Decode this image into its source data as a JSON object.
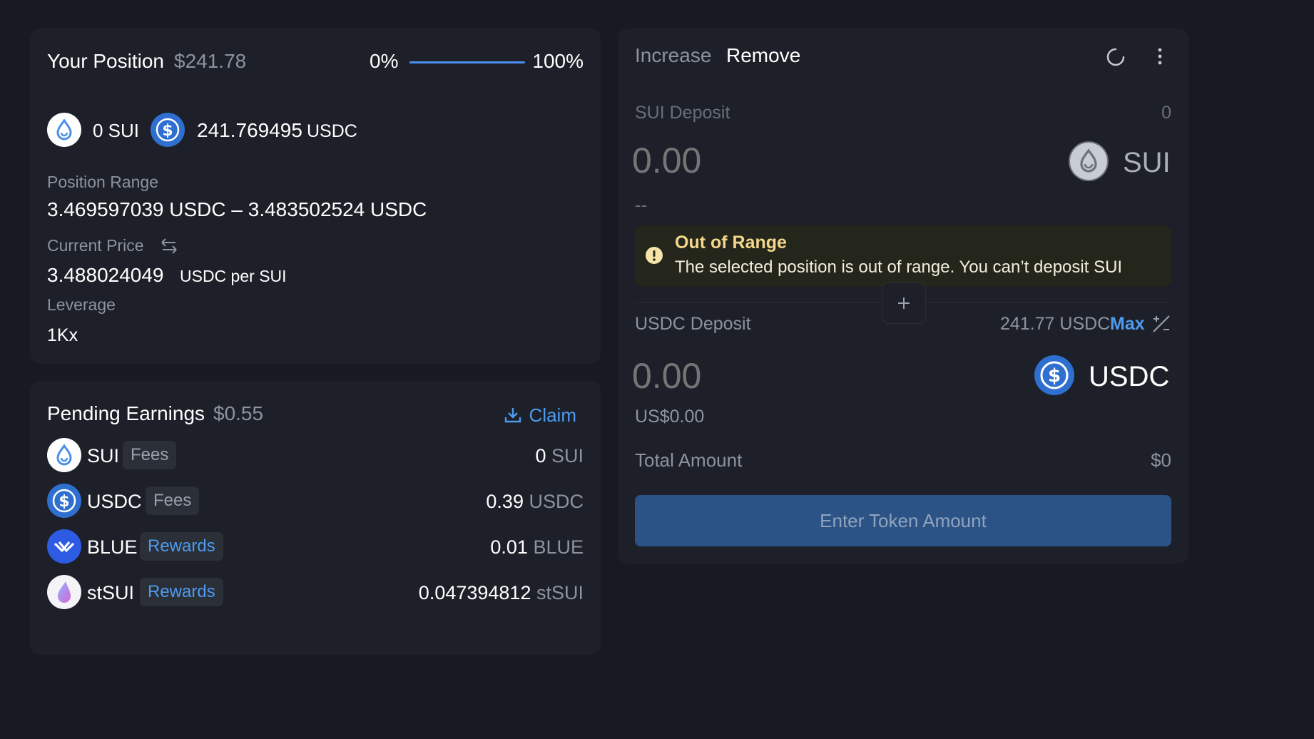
{
  "position": {
    "title": "Your Position",
    "value": "$241.78",
    "range_min_label": "0%",
    "range_max_label": "100%",
    "sui_amount": "0 SUI",
    "usdc_amount_number": "241.769495",
    "usdc_amount_unit": "USDC",
    "range_label": "Position Range",
    "range_value": "3.469597039 USDC – 3.483502524 USDC",
    "current_price_label": "Current Price",
    "current_price_value": "3.488024049",
    "current_price_unit": "USDC per SUI",
    "leverage_label": "Leverage",
    "leverage_value": "1Kx"
  },
  "earnings": {
    "title": "Pending Earnings",
    "value": "$0.55",
    "claim_label": "Claim",
    "rows": [
      {
        "token": "SUI",
        "tag": "Fees",
        "amount": "0",
        "unit": "SUI"
      },
      {
        "token": "USDC",
        "tag": "Fees",
        "amount": "0.39",
        "unit": "USDC"
      },
      {
        "token": "BLUE",
        "tag": "Rewards",
        "amount": "0.01",
        "unit": "BLUE"
      },
      {
        "token": "stSUI",
        "tag": "Rewards",
        "amount": "0.047394812",
        "unit": "stSUI"
      }
    ]
  },
  "manage": {
    "tab_increase": "Increase",
    "tab_remove": "Remove",
    "sui_deposit_label": "SUI Deposit",
    "sui_balance": "0",
    "sui_input_placeholder": "0.00",
    "sui_token_label": "SUI",
    "sui_usd_value": "--",
    "alert_title": "Out of Range",
    "alert_message": "The selected position is out of range. You can’t deposit SUI",
    "usdc_deposit_label": "USDC Deposit",
    "usdc_balance": "241.77 USDC",
    "max_label": "Max",
    "usdc_input_placeholder": "0.00",
    "usdc_token_label": "USDC",
    "usdc_usd_value": "US$0.00",
    "total_label": "Total Amount",
    "total_value": "$0",
    "submit_label": "Enter Token Amount"
  },
  "colors": {
    "background": "#171a21",
    "card": "#1d2028",
    "accent_blue": "#4d9bf0",
    "usdc_blue": "#2f6fcf",
    "button_bg": "#2c5385",
    "button_text": "#8fa3bf",
    "warning_bg": "#25261b",
    "warning_title": "#f4d78a"
  }
}
